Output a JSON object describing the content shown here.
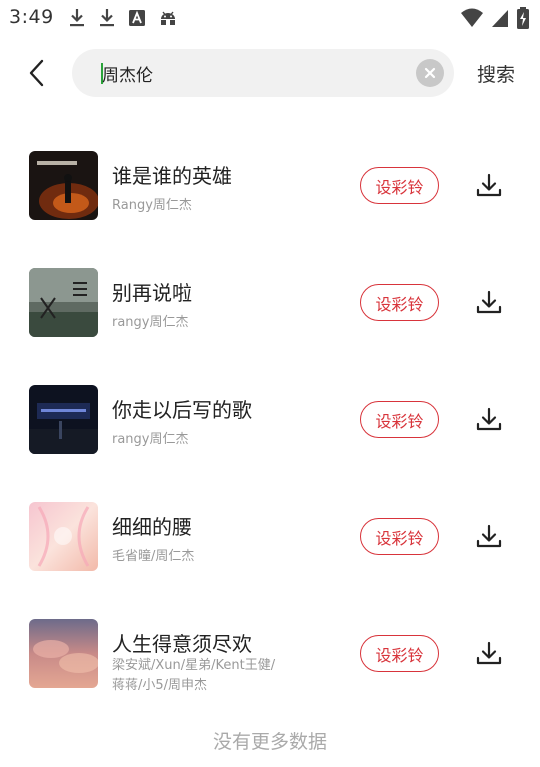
{
  "status_bar": {
    "time": "3:49",
    "left_icons": [
      "download-icon",
      "download-icon",
      "font-app-icon",
      "android-icon"
    ],
    "right_icons": [
      "wifi-icon",
      "cellular-signal-icon",
      "battery-charging-icon"
    ]
  },
  "search": {
    "query": "周杰伦",
    "button_label": "搜索"
  },
  "songs": [
    {
      "title": "谁是谁的英雄",
      "artist": "Rangy周仁杰",
      "ringtone_label": "设彩铃"
    },
    {
      "title": "别再说啦",
      "artist": "rangy周仁杰",
      "ringtone_label": "设彩铃"
    },
    {
      "title": "你走以后写的歌",
      "artist": "rangy周仁杰",
      "ringtone_label": "设彩铃"
    },
    {
      "title": "细细的腰",
      "artist": "毛省曈/周仁杰",
      "ringtone_label": "设彩铃"
    },
    {
      "title": "人生得意须尽欢",
      "artist": "梁安斌/Xun/星弟/Kent王健/蒋蒋/小5/周申杰",
      "ringtone_label": "设彩铃"
    }
  ],
  "footer": {
    "no_more_text": "没有更多数据"
  },
  "colors": {
    "accent_red": "#d8343b",
    "caret_green": "#2aa33a",
    "search_bg": "#f1f1f1"
  }
}
